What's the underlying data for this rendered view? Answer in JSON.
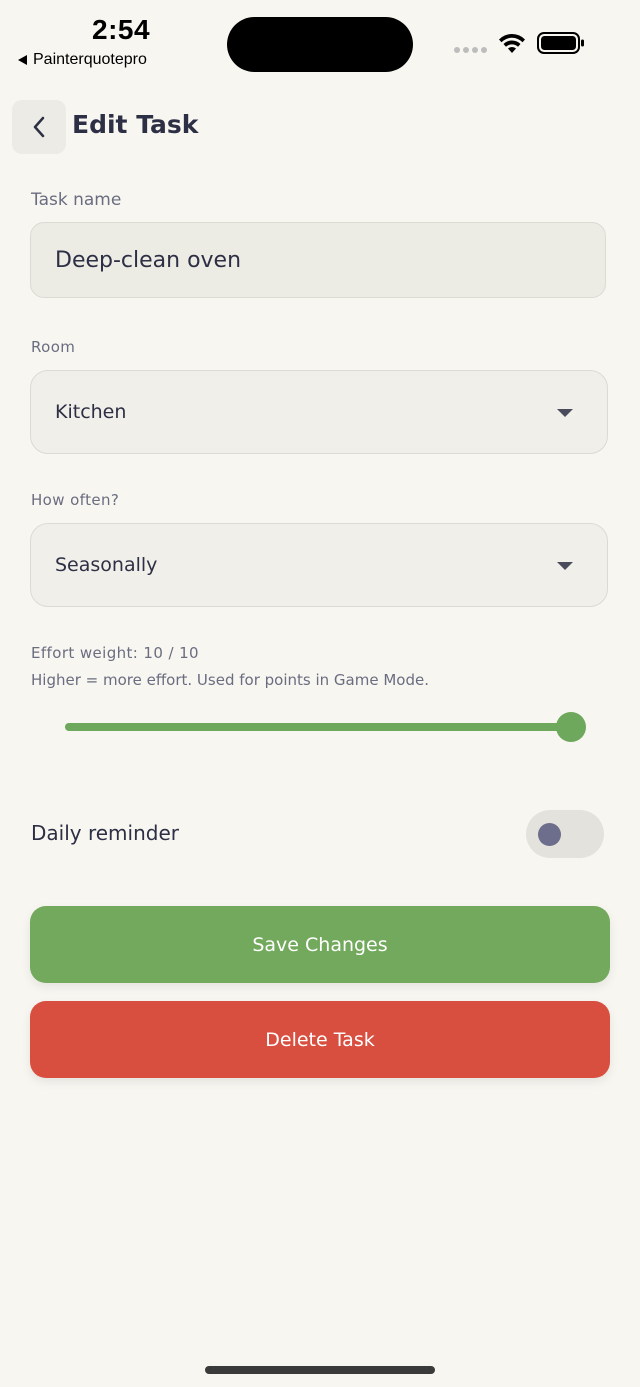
{
  "status_bar": {
    "time": "2:54",
    "back_app": "Painterquotepro"
  },
  "header": {
    "title": "Edit Task",
    "back_icon": "chevron-left-icon"
  },
  "form": {
    "task_name": {
      "label": "Task name",
      "value": "Deep-clean oven"
    },
    "room": {
      "label": "Room",
      "value": "Kitchen"
    },
    "frequency": {
      "label": "How often?",
      "value": "Seasonally"
    },
    "effort": {
      "label": "Effort weight: 10 / 10",
      "hint": "Higher = more effort. Used for points in Game Mode.",
      "value": 10,
      "max": 10
    },
    "reminder": {
      "label": "Daily reminder",
      "enabled": false
    }
  },
  "actions": {
    "save_label": "Save Changes",
    "delete_label": "Delete Task"
  },
  "colors": {
    "background": "#f8f6f1",
    "primary_green": "#72a95d",
    "danger_red": "#d94f3f",
    "text_dark": "#2d2f45",
    "text_muted": "#6a6d80"
  }
}
